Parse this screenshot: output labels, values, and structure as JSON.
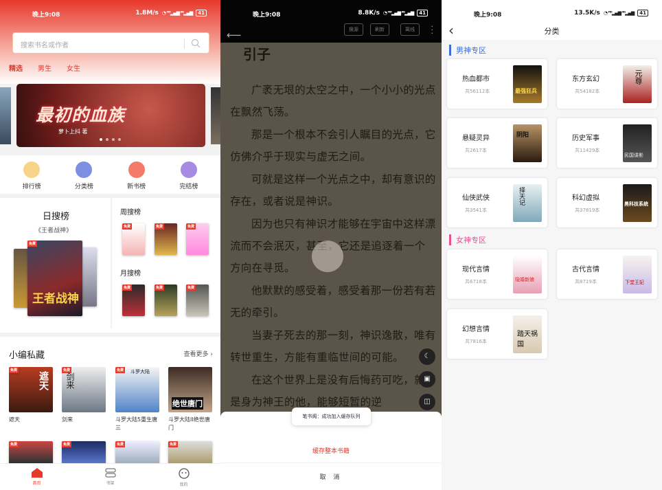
{
  "screen1": {
    "status": {
      "time": "晚上9:08",
      "speed": "1.8M/s",
      "battery": "41"
    },
    "search": {
      "placeholder": "搜索书名或作者"
    },
    "tabs": [
      "精选",
      "男生",
      "女生"
    ],
    "banner": {
      "title": "最初的血族",
      "author": "萝卜上抖 著"
    },
    "quick": [
      {
        "label": "排行榜",
        "color": "#f3c46d"
      },
      {
        "label": "分类榜",
        "color": "#7d8fe3"
      },
      {
        "label": "新书榜",
        "color": "#f47a6b"
      },
      {
        "label": "完结榜",
        "color": "#a78ae3"
      }
    ],
    "daily": {
      "title": "日搜榜",
      "book": "《王者战神》",
      "cover_text": "王者战神"
    },
    "weekly": {
      "title": "周搜榜"
    },
    "monthly": {
      "title": "月搜榜"
    },
    "editor": {
      "title": "小编私藏",
      "more": "查看更多",
      "books": [
        {
          "name": "遮天",
          "cover_text": "遮天"
        },
        {
          "name": "剑来",
          "cover_text": "剑来"
        },
        {
          "name": "斗罗大陆5重生唐三",
          "cover_text": "斗罗大陆"
        },
        {
          "name": "斗罗大陆II绝世唐门",
          "cover_text": "绝世唐门"
        }
      ]
    },
    "nav": [
      {
        "label": "首页"
      },
      {
        "label": "书架"
      },
      {
        "label": "我的"
      }
    ]
  },
  "screen2": {
    "status": {
      "time": "晚上9:08",
      "speed": "8.8K/s",
      "battery": "41"
    },
    "buttons": [
      "换源",
      "刷新",
      "离线"
    ],
    "chapter": "引子",
    "paragraphs": [
      "广袤无垠的太空之中，一个小小的光点在飘然飞荡。",
      "那是一个根本不会引人瞩目的光点，它仿佛介乎于现实与虚无之间。",
      "可就是这样一个光点之中，却有意识的存在，或者说是神识。",
      "因为也只有神识才能够在宇宙中这样漂流而不会泯灭，甚至，它还是追逐着一个方向在寻觅。",
      "他默默的感受着，感受着那一份若有若无的牵引。",
      "当妻子死去的那一刻，神识逸散，唯有转世重生，方能有重临世间的可能。",
      "在这个世界上是没有后悔药可吃，就算是身为神王的他，能够短暂的逆"
    ],
    "toast": "笔书阁：成功加入缓存队列",
    "cache": "缓存整本书籍",
    "cancel": "取 消"
  },
  "screen3": {
    "status": {
      "time": "晚上9:08",
      "speed": "13.5K/s",
      "battery": "41"
    },
    "title": "分类",
    "male_zone": "男神专区",
    "female_zone": "女神专区",
    "male": [
      {
        "name": "热血都市",
        "count": "共56112本",
        "cover_text": "最强狂兵"
      },
      {
        "name": "东方玄幻",
        "count": "共54182本",
        "cover_text": "元尊"
      },
      {
        "name": "悬疑灵异",
        "count": "共2617本",
        "cover_text": "阴阳"
      },
      {
        "name": "历史军事",
        "count": "共11429本",
        "cover_text": "民国谍影"
      },
      {
        "name": "仙侠武侠",
        "count": "共3541本",
        "cover_text": "择天记"
      },
      {
        "name": "科幻虚拟",
        "count": "共37819本",
        "cover_text": "黑科技系统"
      }
    ],
    "female": [
      {
        "name": "现代言情",
        "count": "共6718本",
        "cover_text": "隐婚新娘"
      },
      {
        "name": "古代言情",
        "count": "共8719本",
        "cover_text": "下堂王妃"
      },
      {
        "name": "幻想言情",
        "count": "共7816本",
        "cover_text": "踏天祸国"
      }
    ]
  }
}
